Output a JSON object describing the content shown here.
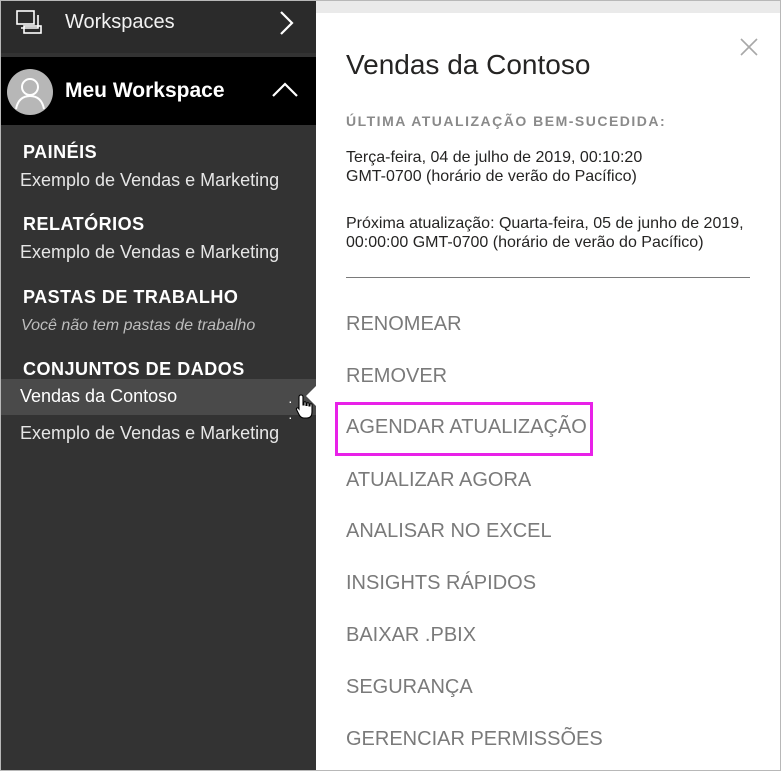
{
  "sidebar": {
    "workspaces_label": "Workspaces",
    "my_workspace_label": "Meu Workspace",
    "sections": {
      "dashboards": {
        "title": "PAINÉIS",
        "items": [
          "Exemplo de Vendas e Marketing"
        ]
      },
      "reports": {
        "title": "RELATÓRIOS",
        "items": [
          "Exemplo de Vendas e Marketing"
        ]
      },
      "workbooks": {
        "title": "PASTAS DE TRABALHO",
        "empty_text": "Você não tem pastas de trabalho"
      },
      "datasets": {
        "title": "CONJUNTOS DE DADOS",
        "items": [
          "Vendas da Contoso",
          "Exemplo de Vendas e Marketing"
        ]
      }
    },
    "more_options": "· · ·",
    "icons": {
      "workspaces": "workspaces-icon",
      "chevron_right": "chevron-right-icon",
      "avatar": "person-icon",
      "chevron_up": "chevron-up-icon",
      "cursor": "hand-cursor-icon"
    }
  },
  "panel": {
    "title": "Vendas da Contoso",
    "last_refresh_label": "ÚLTIMA ATUALIZAÇÃO BEM-SUCEDIDA:",
    "last_refresh_line1": "Terça-feira, 04 de julho de 2019, 00:10:20",
    "last_refresh_line2": "GMT-0700 (horário de verão do Pacífico)",
    "next_refresh_line1": "Próxima atualização: Quarta-feira, 05 de junho de 2019,",
    "next_refresh_line2": "00:00:00 GMT-0700 (horário de verão do Pacífico)",
    "menu": [
      "RENOMEAR",
      "REMOVER",
      "AGENDAR ATUALIZAÇÃO",
      "ATUALIZAR AGORA",
      "ANALISAR NO EXCEL",
      "INSIGHTS RÁPIDOS",
      "BAIXAR .PBIX",
      "SEGURANÇA",
      "GERENCIAR PERMISSÕES"
    ],
    "highlight_color": "#e821e8",
    "close_icon": "close-icon"
  }
}
